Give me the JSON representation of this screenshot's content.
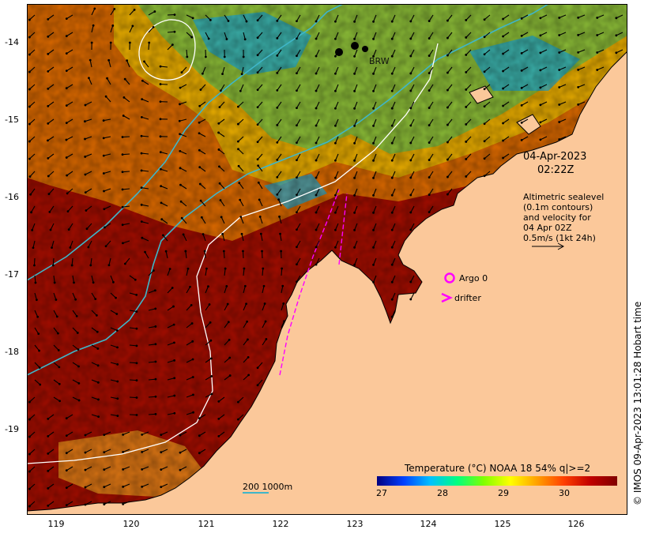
{
  "map": {
    "lat_ticks": [
      "-14",
      "-15",
      "-16",
      "-17",
      "-18",
      "-19"
    ],
    "lon_ticks": [
      "119",
      "120",
      "121",
      "122",
      "123",
      "124",
      "125",
      "126"
    ],
    "date": "04-Apr-2023",
    "time": "02:22Z",
    "alt_text": [
      "Altimetric sealevel",
      "(0.1m contours)",
      "and velocity for",
      "04 Apr 02Z",
      "0.5m/s (1kt 24h)"
    ],
    "legend": {
      "argo": "Argo 0",
      "drifter": "drifter"
    },
    "scale_text": "200  1000m",
    "station_label": "BRW",
    "stamp": "© IMOS 09-Apr-2023 13:01:28 Hobart time",
    "colorbar": {
      "title": "Temperature (°C) NOAA 18 54% q|>=2",
      "ticks": [
        "27",
        "28",
        "29",
        "30"
      ],
      "colors": [
        "#000080",
        "#0040ff",
        "#00c0ff",
        "#00ff80",
        "#80ff00",
        "#ffff00",
        "#ffa000",
        "#ff4000",
        "#c00000",
        "#800000"
      ]
    },
    "colors": {
      "land": "#fbc89a",
      "sea_warm": "#a30d00",
      "contour_cyan": "#3fb6c9",
      "magenta": "#ff00ff"
    }
  }
}
